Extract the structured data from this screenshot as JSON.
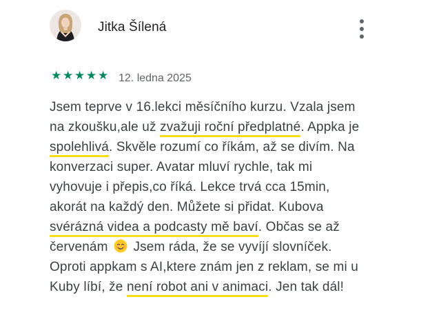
{
  "review": {
    "author": "Jitka Šílená",
    "rating": 5,
    "rating_max": 5,
    "star_color": "#01875f",
    "highlight_color": "#f7dc1c",
    "date": "12. ledna 2025",
    "lines": [
      {
        "a": "Jsem teprve v 16.lekci měsíčního kurzu. Vzala jsem"
      },
      {
        "a": "na zkoušku,ale už ",
        "h": "zvažuji roční předplatné",
        "b": ". Appka je"
      },
      {
        "h": "spolehlivá",
        "b": ". Skvěle rozumí co říkám, až se divím. Na"
      },
      {
        "a": "konverzaci super. Avatar mluví rychle, tak mi"
      },
      {
        "a": "vyhovuje i přepis,co říká. Lekce trvá cca 15min,"
      },
      {
        "a": "akorát na každý den. Můžete si přidat. Kubova"
      },
      {
        "h": "svérázná videa a podcasty mě baví",
        "b": ". Občas se až"
      },
      {
        "a": "červenám ",
        "emoji": "smiling-face-emoji",
        "b": " Jsem ráda, že se vyvíjí slovníček."
      },
      {
        "a": "Oproti appkam s AI,ktere znám jen z reklam, se mi u"
      },
      {
        "a": "Kuby líbí, že ",
        "h": "není robot ani v animaci",
        "b": ". Jen tak dál!"
      }
    ]
  },
  "icons": {
    "menu": "more-vert-icon",
    "star": "star-icon",
    "avatar": "profile-photo"
  }
}
